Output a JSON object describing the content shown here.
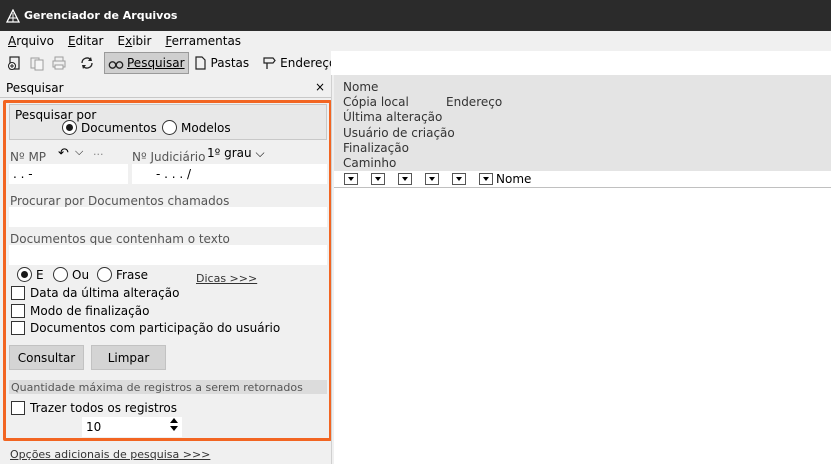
{
  "window": {
    "title": "Gerenciador de Arquivos"
  },
  "menu": [
    {
      "label_u": "A",
      "label_rest": "rquivo"
    },
    {
      "label_u": "E",
      "label_rest": "ditar"
    },
    {
      "label_u": "E",
      "label_rest": "xibir"
    },
    {
      "label_u": "F",
      "label_rest": "erramentas"
    }
  ],
  "toolbar": {
    "search_label": "Pesquisar",
    "folders_label": "Pastas",
    "address_label": "Endereço"
  },
  "panel": {
    "title": "Pesquisar",
    "close_glyph": "×",
    "search_by": {
      "legend": "Pesquisar por",
      "options": [
        "Documentos",
        "Modelos"
      ],
      "selected": "Documentos"
    },
    "mp": {
      "label": "Nº MP",
      "value": ". .    -",
      "ellipsis": "···"
    },
    "judicial": {
      "label": "Nº Judiciário",
      "grade": "1º grau",
      "value": "-  .  .  .      /"
    },
    "search_docs_named": {
      "label": "Procurar por Documentos chamados",
      "value": ""
    },
    "search_text": {
      "label": "Documentos que contenham o texto",
      "value": ""
    },
    "text_mode": {
      "options": [
        "E",
        "Ou",
        "Frase"
      ],
      "selected": "E",
      "tips": "Dicas >>>"
    },
    "checks": [
      {
        "label": "Data da última alteração",
        "checked": false
      },
      {
        "label": "Modo de finalização",
        "checked": false
      },
      {
        "label": "Documentos com participação do usuário",
        "checked": false
      }
    ],
    "buttons": {
      "search": "Consultar",
      "clear": "Limpar"
    },
    "max_records": {
      "section": "Quantidade máxima de registros a serem retornados",
      "all_label": "Trazer todos os registros",
      "all_checked": false,
      "value": "10"
    },
    "more_options": "Opções adicionais de pesquisa >>>"
  },
  "details": {
    "labels": [
      "Nome",
      "Cópia local",
      "Última alteração",
      "Usuário de criação",
      "Finalização",
      "Caminho"
    ],
    "address_label": "Endereço",
    "column": "Nome"
  }
}
